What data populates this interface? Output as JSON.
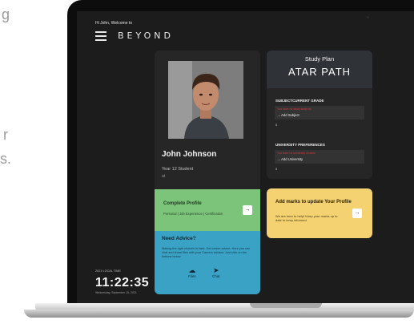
{
  "side_text": [
    "g",
    "r",
    "s."
  ],
  "header": {
    "greeting": "Hi John, Welcome to",
    "brand": "BEYOND"
  },
  "profile": {
    "name": "John Johnson",
    "year": "Year 12 Student",
    "school": "at"
  },
  "complete_profile": {
    "title": "Complete Profile",
    "subtitle": "Personal | Job Experience | Certification",
    "arrow": "→"
  },
  "advice": {
    "title": "Need Advice?",
    "body": "Making the right choices is hard. Get career advice. Here you can chat and share files with your Careers advisor. Just click on the buttons below.",
    "files_label": "Files",
    "chat_label": "Chat"
  },
  "study_plan": {
    "label": "Study Plan",
    "path": "ATAR PATH",
    "subjects": {
      "title": "SUBJECTCURRENT GRADE",
      "warning": "You have no study subjects",
      "add_label": "→ Add Subject",
      "count": "0"
    },
    "university": {
      "title": "UNIVERSITY PREFERENCES",
      "warning": "You have no university choices",
      "add_label": "→ Add University",
      "count": "0"
    }
  },
  "marks": {
    "title": "Add marks to update Your Profile",
    "subtitle": "We are here to help! Keep your marks up to date to keep informed",
    "arrow": "→"
  },
  "clock": {
    "label": "2021 LOCAL TIME",
    "time": "11:22:35",
    "date": "Wednesday, September 15, 2021"
  },
  "colors": {
    "green_card": "#7cc47a",
    "blue_card": "#3aa2c5",
    "yellow_card": "#f4d272",
    "warning_red": "#d33a3a"
  }
}
